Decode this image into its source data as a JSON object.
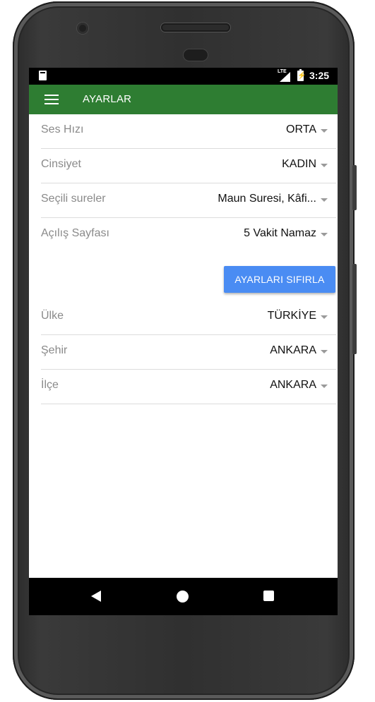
{
  "statusbar": {
    "network": "LTE",
    "time": "3:25"
  },
  "appbar": {
    "title": "AYARLAR"
  },
  "settings": [
    {
      "label": "Ses Hızı",
      "value": "ORTA"
    },
    {
      "label": "Cinsiyet",
      "value": "KADIN"
    },
    {
      "label": "Seçili sureler",
      "value": "Maun Suresi, Kâfi..."
    },
    {
      "label": "Açılış Sayfası",
      "value": "5 Vakit Namaz"
    }
  ],
  "reset_button": {
    "label": "AYARLARI SIFIRLA",
    "color": "#4a8cf3"
  },
  "location": [
    {
      "label": "Ülke",
      "value": "TÜRKİYE"
    },
    {
      "label": "Şehir",
      "value": "ANKARA"
    },
    {
      "label": "İlçe",
      "value": "ANKARA"
    }
  ],
  "colors": {
    "appbar": "#2e7d32",
    "primary_button": "#4a8cf3"
  },
  "icons": {
    "menu": "hamburger-menu-icon",
    "dropdown": "dropdown-caret-icon",
    "back": "nav-back-icon",
    "home": "nav-home-icon",
    "recent": "nav-recent-icon"
  }
}
